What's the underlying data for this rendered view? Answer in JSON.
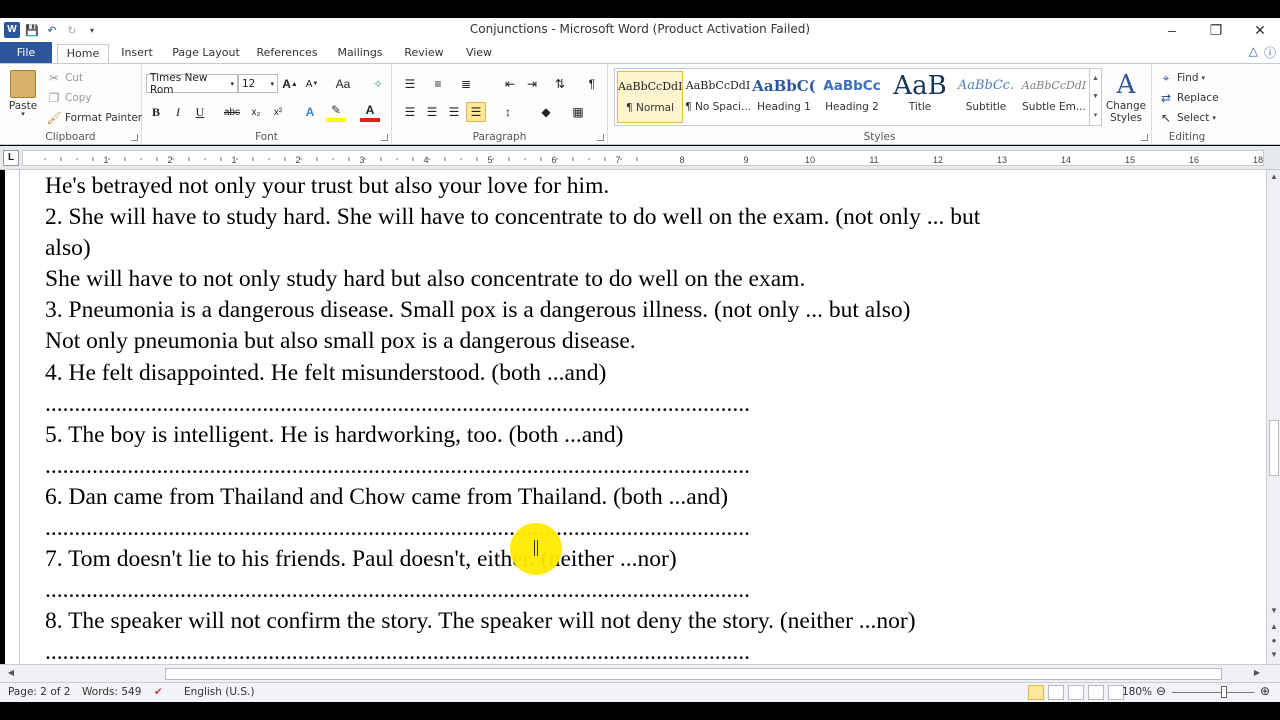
{
  "window": {
    "title": "Conjunctions  -  Microsoft Word (Product Activation Failed)",
    "app_icon": "W"
  },
  "tabs": [
    {
      "label": "File"
    },
    {
      "label": "Home"
    },
    {
      "label": "Insert"
    },
    {
      "label": "Page Layout"
    },
    {
      "label": "References"
    },
    {
      "label": "Mailings"
    },
    {
      "label": "Review"
    },
    {
      "label": "View"
    }
  ],
  "active_tab": "Home",
  "ribbon": {
    "clipboard": {
      "label": "Clipboard",
      "paste": "Paste",
      "cut": "Cut",
      "copy": "Copy",
      "format_painter": "Format Painter"
    },
    "font": {
      "label": "Font",
      "family": "Times New Rom",
      "size": "12",
      "bold": "B",
      "italic": "I",
      "underline": "U",
      "strike": "abc",
      "sub": "x₂",
      "sup": "x²",
      "grow": "A",
      "shrink": "A",
      "case": "Aa",
      "font_color": "A",
      "highlight_color": "#ffff00",
      "text_color": "#e0221f"
    },
    "paragraph": {
      "label": "Paragraph",
      "show_marks": "¶"
    },
    "styles": {
      "label": "Styles",
      "items": [
        {
          "preview": "AaBbCcDdI",
          "name": "¶ Normal"
        },
        {
          "preview": "AaBbCcDdI",
          "name": "¶ No Spaci..."
        },
        {
          "preview": "AaBbC(",
          "name": "Heading 1"
        },
        {
          "preview": "AaBbCc",
          "name": "Heading 2"
        },
        {
          "preview": "AaB",
          "name": "Title"
        },
        {
          "preview": "AaBbCc.",
          "name": "Subtitle"
        },
        {
          "preview": "AaBbCcDdI",
          "name": "Subtle Em..."
        }
      ],
      "change_styles": "Change Styles"
    },
    "editing": {
      "label": "Editing",
      "find": "Find",
      "replace": "Replace",
      "select": "Select"
    }
  },
  "ruler_numbers": [
    "1",
    "2",
    "1",
    "2",
    "3",
    "4",
    "5",
    "6",
    "7",
    "8",
    "9",
    "10",
    "11",
    "12",
    "13",
    "14",
    "15",
    "16",
    "18",
    "19"
  ],
  "document": {
    "lines": [
      "He's betrayed not only your trust but also your love for him.",
      "2. She will have to study hard. She will have to concentrate to do well on the exam. (not only ... but",
      "also)",
      "She will have to not only study hard but also concentrate to do well on the exam.",
      "3. Pneumonia is a dangerous disease. Small pox is a dangerous illness. (not only ... but also)",
      "Not only pneumonia but also small pox is a dangerous disease.",
      "4. He felt disappointed. He felt misunderstood. (both ...and)",
      "........................................................................................................................",
      "5. The boy is intelligent. He is hardworking, too. (both ...and)",
      "........................................................................................................................",
      "6. Dan came from Thailand and Chow came from Thailand. (both ...and)",
      "........................................................................................................................",
      "7. Tom doesn't lie to his friends. Paul doesn't, either. (neither ...nor)",
      "........................................................................................................................",
      "8. The speaker will not confirm the story. The speaker will not deny the story. (neither ...nor)",
      "........................................................................................................................"
    ]
  },
  "status": {
    "page": "Page: 2 of 2",
    "words": "Words: 549",
    "language": "English (U.S.)",
    "zoom": "180%",
    "zoom_level": 1.8
  },
  "colors": {
    "accent": "#2b579a",
    "cursor_highlight": "#ffeb00"
  }
}
